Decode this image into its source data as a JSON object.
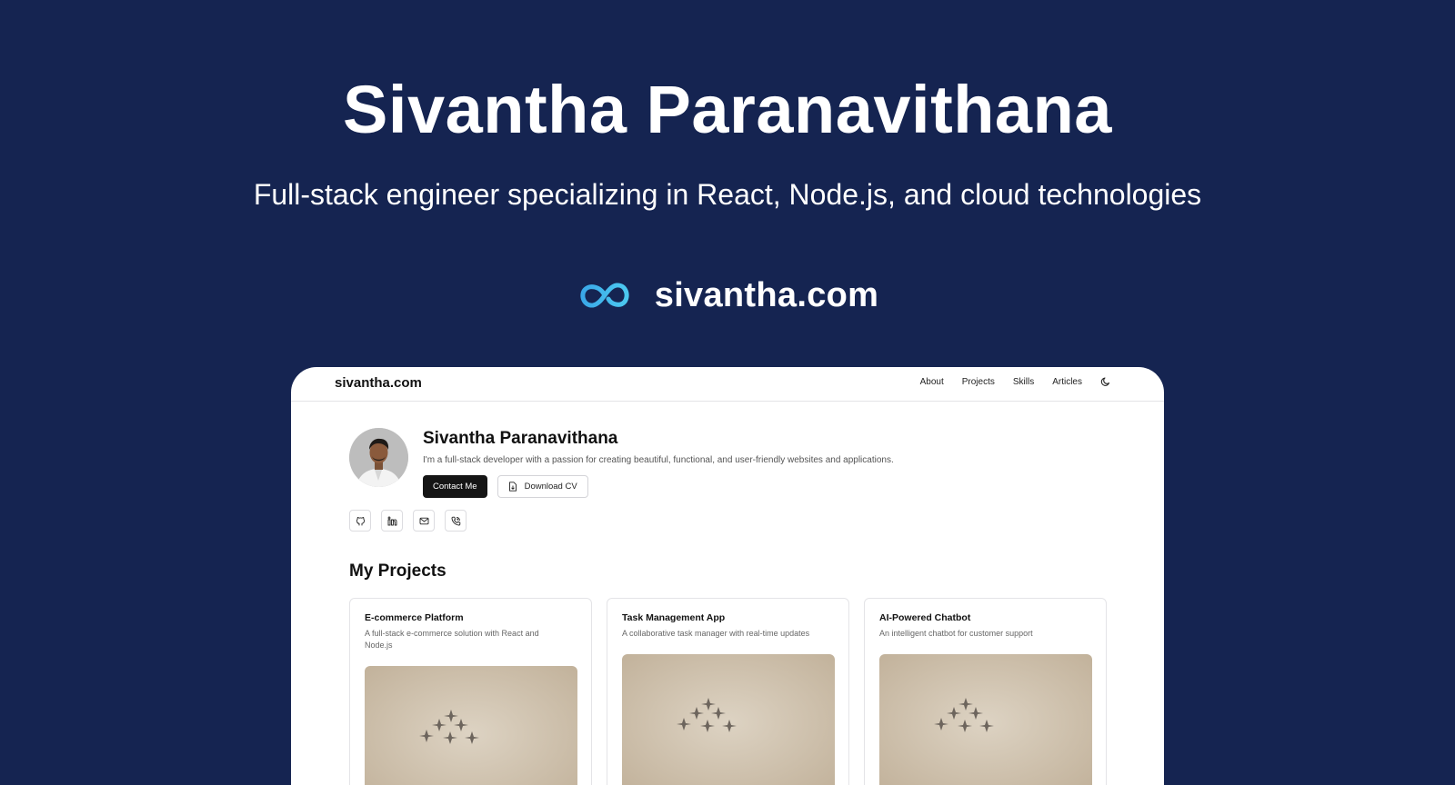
{
  "hero": {
    "title": "Sivantha Paranavithana",
    "subtitle": "Full-stack engineer specializing in React, Node.js, and cloud technologies",
    "domain": "sivantha.com",
    "logo_icon": "infinity-logo-icon",
    "logo_color": "#4cc9f0"
  },
  "site": {
    "nav": {
      "brand": "sivantha.com",
      "links": [
        "About",
        "Projects",
        "Skills",
        "Articles"
      ],
      "theme_toggle_icon": "moon-icon"
    },
    "profile": {
      "name": "Sivantha Paranavithana",
      "bio": "I'm a full-stack developer with a passion for creating beautiful, functional, and user-friendly websites and applications.",
      "contact_label": "Contact Me",
      "download_label": "Download CV",
      "download_icon": "file-download-icon",
      "social_icons": [
        "github-icon",
        "linkedin-icon",
        "mail-icon",
        "phone-icon"
      ]
    },
    "projects": {
      "title": "My Projects",
      "items": [
        {
          "title": "E-commerce Platform",
          "description": "A full-stack e-commerce solution with React and Node.js"
        },
        {
          "title": "Task Management App",
          "description": "A collaborative task manager with real-time updates"
        },
        {
          "title": "AI-Powered Chatbot",
          "description": "An intelligent chatbot for customer support"
        }
      ]
    }
  },
  "colors": {
    "background": "#152451",
    "primary_button": "#151515",
    "text_dark": "#111111"
  }
}
